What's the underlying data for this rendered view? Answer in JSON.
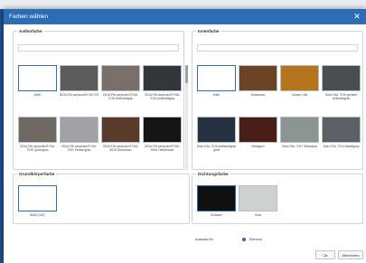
{
  "dialog": {
    "title": "Farben wählen"
  },
  "aussen": {
    "legend": "Außenfarbe",
    "labels": [
      "Weiß",
      "DEALFIN acrylcolor® DB 703",
      "DEALFIN acrylcolor® RAL 7016 Anthrazitgrau",
      "DEALFIN acrylcolor® RAL 7015 Anthrazitgrau",
      "DEALFIN acrylcolor® RAL 7039 Quarzgrau",
      "DEALFIN acrylcolor® RAL 7001 Fenstergrau",
      "DEALFIN acrylcolor® RAL 8019 Graubraun",
      "DEALFIN acrylcolor® RAL 9005 Tiefschwarz"
    ]
  },
  "innen": {
    "legend": "Innenfarbe",
    "labels": [
      "Weiß",
      "Nussbaum",
      "Golden Oak",
      "Deko RAL 7016 genarbt Anthrazitgrau",
      "Deko RAL 7016 Anthrazitgrau glatt",
      "Mahagoni",
      "Deko RAL 7037 Silbergrau",
      "Deko RAL 7012 Basaltgrau"
    ]
  },
  "grund": {
    "legend": "Grundkörperfarbe",
    "labels": [
      "Weiß (CAT)"
    ]
  },
  "dicht": {
    "legend": "Dichtungsfarbe",
    "labels": [
      "Schwarz",
      "Grau"
    ]
  },
  "footer": {
    "label": "Auswahl für",
    "option": "Element"
  },
  "buttons": {
    "ok": "Ok",
    "cancel": "Abbrechen"
  },
  "colors": {
    "aussen": [
      "#ffffff",
      "#5c5c5a",
      "#7a706b",
      "#33373c",
      "#6e6a63",
      "#9ea2a5",
      "#5a3a28",
      "#141414"
    ],
    "innen": [
      "#ffffff",
      "#6a4424",
      "#b5731e",
      "#4a4e53",
      "#263142",
      "#4a1e16",
      "#8c9393",
      "#5b6066"
    ],
    "grund": [
      "#ffffff"
    ],
    "dicht": [
      "#0f0f0f",
      "#cfd1cf"
    ]
  }
}
